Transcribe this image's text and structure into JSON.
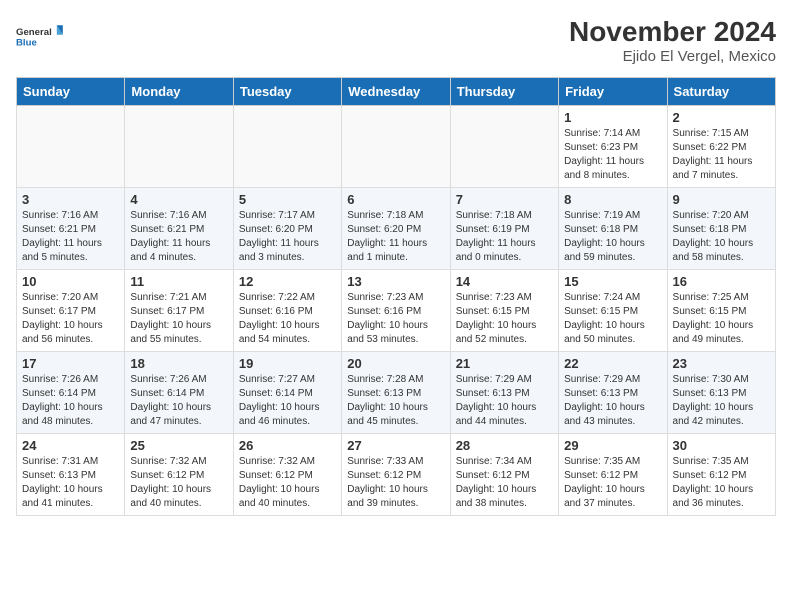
{
  "header": {
    "logo_line1": "General",
    "logo_line2": "Blue",
    "month_year": "November 2024",
    "location": "Ejido El Vergel, Mexico"
  },
  "days_of_week": [
    "Sunday",
    "Monday",
    "Tuesday",
    "Wednesday",
    "Thursday",
    "Friday",
    "Saturday"
  ],
  "weeks": [
    [
      {
        "day": "",
        "info": ""
      },
      {
        "day": "",
        "info": ""
      },
      {
        "day": "",
        "info": ""
      },
      {
        "day": "",
        "info": ""
      },
      {
        "day": "",
        "info": ""
      },
      {
        "day": "1",
        "info": "Sunrise: 7:14 AM\nSunset: 6:23 PM\nDaylight: 11 hours and 8 minutes."
      },
      {
        "day": "2",
        "info": "Sunrise: 7:15 AM\nSunset: 6:22 PM\nDaylight: 11 hours and 7 minutes."
      }
    ],
    [
      {
        "day": "3",
        "info": "Sunrise: 7:16 AM\nSunset: 6:21 PM\nDaylight: 11 hours and 5 minutes."
      },
      {
        "day": "4",
        "info": "Sunrise: 7:16 AM\nSunset: 6:21 PM\nDaylight: 11 hours and 4 minutes."
      },
      {
        "day": "5",
        "info": "Sunrise: 7:17 AM\nSunset: 6:20 PM\nDaylight: 11 hours and 3 minutes."
      },
      {
        "day": "6",
        "info": "Sunrise: 7:18 AM\nSunset: 6:20 PM\nDaylight: 11 hours and 1 minute."
      },
      {
        "day": "7",
        "info": "Sunrise: 7:18 AM\nSunset: 6:19 PM\nDaylight: 11 hours and 0 minutes."
      },
      {
        "day": "8",
        "info": "Sunrise: 7:19 AM\nSunset: 6:18 PM\nDaylight: 10 hours and 59 minutes."
      },
      {
        "day": "9",
        "info": "Sunrise: 7:20 AM\nSunset: 6:18 PM\nDaylight: 10 hours and 58 minutes."
      }
    ],
    [
      {
        "day": "10",
        "info": "Sunrise: 7:20 AM\nSunset: 6:17 PM\nDaylight: 10 hours and 56 minutes."
      },
      {
        "day": "11",
        "info": "Sunrise: 7:21 AM\nSunset: 6:17 PM\nDaylight: 10 hours and 55 minutes."
      },
      {
        "day": "12",
        "info": "Sunrise: 7:22 AM\nSunset: 6:16 PM\nDaylight: 10 hours and 54 minutes."
      },
      {
        "day": "13",
        "info": "Sunrise: 7:23 AM\nSunset: 6:16 PM\nDaylight: 10 hours and 53 minutes."
      },
      {
        "day": "14",
        "info": "Sunrise: 7:23 AM\nSunset: 6:15 PM\nDaylight: 10 hours and 52 minutes."
      },
      {
        "day": "15",
        "info": "Sunrise: 7:24 AM\nSunset: 6:15 PM\nDaylight: 10 hours and 50 minutes."
      },
      {
        "day": "16",
        "info": "Sunrise: 7:25 AM\nSunset: 6:15 PM\nDaylight: 10 hours and 49 minutes."
      }
    ],
    [
      {
        "day": "17",
        "info": "Sunrise: 7:26 AM\nSunset: 6:14 PM\nDaylight: 10 hours and 48 minutes."
      },
      {
        "day": "18",
        "info": "Sunrise: 7:26 AM\nSunset: 6:14 PM\nDaylight: 10 hours and 47 minutes."
      },
      {
        "day": "19",
        "info": "Sunrise: 7:27 AM\nSunset: 6:14 PM\nDaylight: 10 hours and 46 minutes."
      },
      {
        "day": "20",
        "info": "Sunrise: 7:28 AM\nSunset: 6:13 PM\nDaylight: 10 hours and 45 minutes."
      },
      {
        "day": "21",
        "info": "Sunrise: 7:29 AM\nSunset: 6:13 PM\nDaylight: 10 hours and 44 minutes."
      },
      {
        "day": "22",
        "info": "Sunrise: 7:29 AM\nSunset: 6:13 PM\nDaylight: 10 hours and 43 minutes."
      },
      {
        "day": "23",
        "info": "Sunrise: 7:30 AM\nSunset: 6:13 PM\nDaylight: 10 hours and 42 minutes."
      }
    ],
    [
      {
        "day": "24",
        "info": "Sunrise: 7:31 AM\nSunset: 6:13 PM\nDaylight: 10 hours and 41 minutes."
      },
      {
        "day": "25",
        "info": "Sunrise: 7:32 AM\nSunset: 6:12 PM\nDaylight: 10 hours and 40 minutes."
      },
      {
        "day": "26",
        "info": "Sunrise: 7:32 AM\nSunset: 6:12 PM\nDaylight: 10 hours and 40 minutes."
      },
      {
        "day": "27",
        "info": "Sunrise: 7:33 AM\nSunset: 6:12 PM\nDaylight: 10 hours and 39 minutes."
      },
      {
        "day": "28",
        "info": "Sunrise: 7:34 AM\nSunset: 6:12 PM\nDaylight: 10 hours and 38 minutes."
      },
      {
        "day": "29",
        "info": "Sunrise: 7:35 AM\nSunset: 6:12 PM\nDaylight: 10 hours and 37 minutes."
      },
      {
        "day": "30",
        "info": "Sunrise: 7:35 AM\nSunset: 6:12 PM\nDaylight: 10 hours and 36 minutes."
      }
    ]
  ]
}
